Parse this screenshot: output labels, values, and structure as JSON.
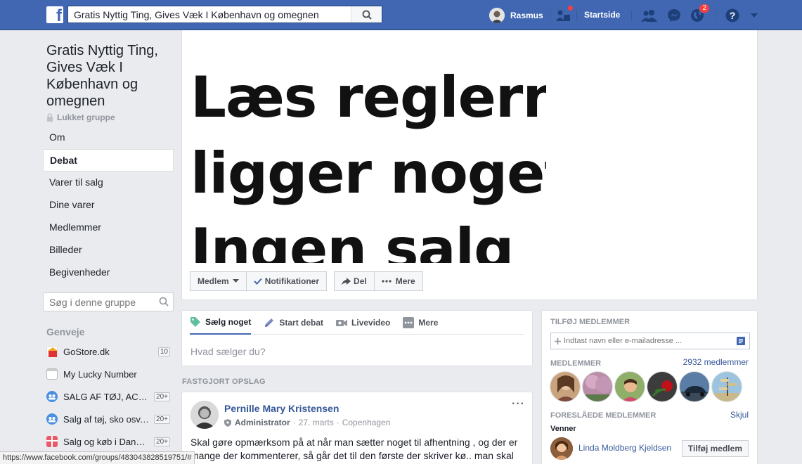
{
  "topbar": {
    "search_value": "Gratis Nyttig Ting, Gives Væk I København og omegnen",
    "user_name": "Rasmus",
    "home_label": "Startside",
    "notifications_count": "2"
  },
  "group": {
    "title": "Gratis Nyttig Ting, Gives Væk I København og omegnen",
    "privacy": "Lukket gruppe",
    "nav": [
      "Om",
      "Debat",
      "Varer til salg",
      "Dine varer",
      "Medlemmer",
      "Billeder",
      "Begivenheder"
    ],
    "search_placeholder": "Søg i denne gruppe"
  },
  "shortcuts": {
    "title": "Genveje",
    "items": [
      {
        "label": "GoStore.dk",
        "count": "10"
      },
      {
        "label": "My Lucky Number",
        "count": ""
      },
      {
        "label": "SALG AF TØJ, ACCESSORIES",
        "count": "20+"
      },
      {
        "label": "Salg af tøj, sko osv. i Danmark",
        "count": "20+"
      },
      {
        "label": "Salg og køb i Danmark",
        "count": "20+"
      }
    ]
  },
  "cover": {
    "text_lines": [
      "Læs reglerne før du",
      "ligger noget op!",
      "Ingen salg"
    ]
  },
  "cover_actions": {
    "member": "Medlem",
    "notifications": "Notifikationer",
    "share": "Del",
    "more": "Mere"
  },
  "composer": {
    "tabs": [
      "Sælg noget",
      "Start debat",
      "Livevideo",
      "Mere"
    ],
    "placeholder": "Hvad sælger du?"
  },
  "pinned": {
    "label": "FASTGJORT OPSLAG",
    "author": "Pernille Mary Kristensen",
    "role": "Administrator",
    "date": "27. marts",
    "location": "Copenhagen",
    "body": "Skal gøre opmærksom på at når man sætter noget til afhentning , og der er mange der kommenterer, så går det til den første der skriver kø.. man skal ikke skrive i privat besked hvad man vil give for tingene når andre"
  },
  "right": {
    "add_members_title": "TILFØJ MEDLEMMER",
    "add_members_placeholder": "Indtast navn eller e-mailadresse ...",
    "members_title": "MEDLEMMER",
    "members_count": "2932 medlemmer",
    "suggested_title": "FORESLÅEDE MEDLEMMER",
    "hide": "Skjul",
    "friends": "Venner",
    "suggested_name": "Linda Moldberg Kjeldsen",
    "add_button": "Tilføj medlem"
  },
  "statusbar": {
    "url": "https://www.facebook.com/groups/483043828519751/#"
  }
}
